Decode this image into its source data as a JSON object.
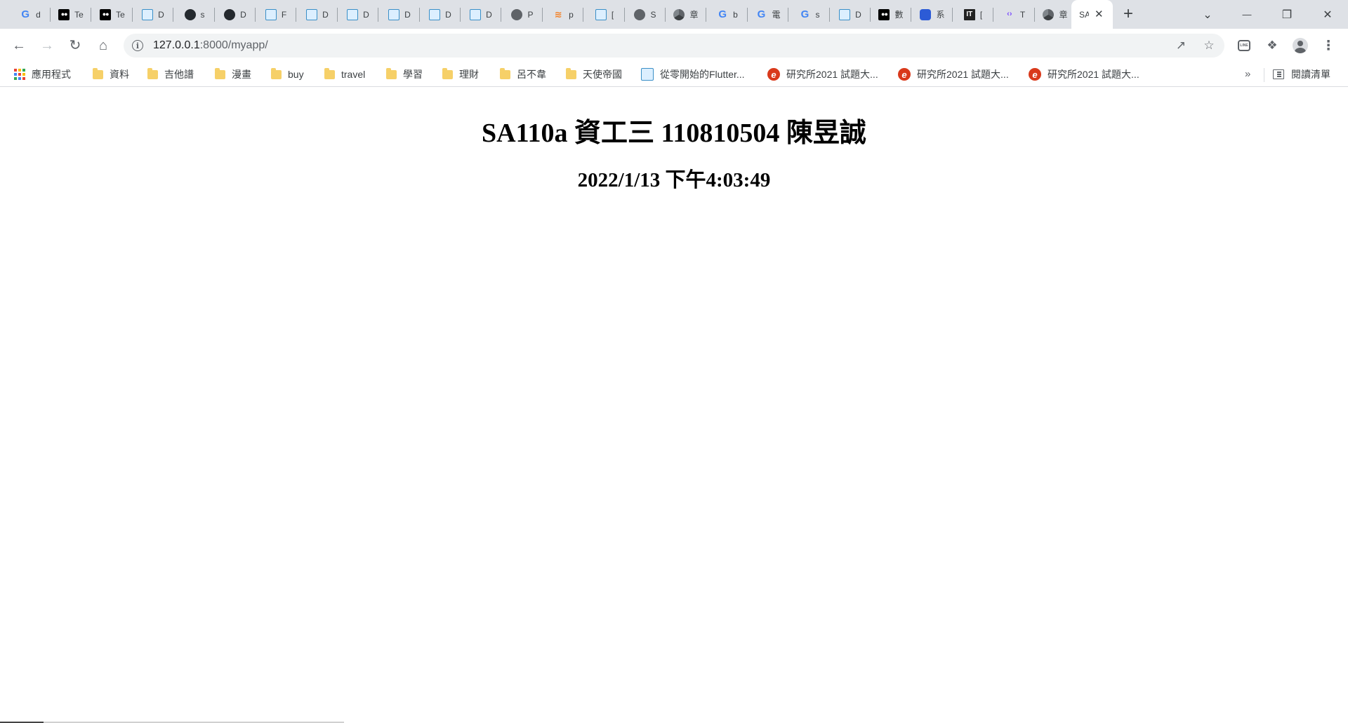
{
  "tabs": [
    {
      "favicon": "google-icon",
      "title": "d"
    },
    {
      "favicon": "medium-icon",
      "title": "Te"
    },
    {
      "favicon": "medium-icon",
      "title": "Te"
    },
    {
      "favicon": "web-icon",
      "title": "D"
    },
    {
      "favicon": "github-icon",
      "title": "s"
    },
    {
      "favicon": "github-icon",
      "title": "D"
    },
    {
      "favicon": "web-icon",
      "title": "F"
    },
    {
      "favicon": "web-icon",
      "title": "D"
    },
    {
      "favicon": "web-icon",
      "title": "D"
    },
    {
      "favicon": "web-icon",
      "title": "D"
    },
    {
      "favicon": "web-icon",
      "title": "D"
    },
    {
      "favicon": "web-icon",
      "title": "D"
    },
    {
      "favicon": "globe-icon",
      "title": "P"
    },
    {
      "favicon": "stackoverflow-icon",
      "title": "p"
    },
    {
      "favicon": "web-icon",
      "title": "["
    },
    {
      "favicon": "globe-icon",
      "title": "S"
    },
    {
      "favicon": "chrome-icon",
      "title": "章"
    },
    {
      "favicon": "google-icon",
      "title": "b"
    },
    {
      "favicon": "google-icon",
      "title": "電"
    },
    {
      "favicon": "google-icon",
      "title": "s"
    },
    {
      "favicon": "web-icon",
      "title": "D"
    },
    {
      "favicon": "medium-icon",
      "title": "數"
    },
    {
      "favicon": "blue-app-icon",
      "title": "系"
    },
    {
      "favicon": "ithome-icon",
      "title": "["
    },
    {
      "favicon": "code-icon",
      "title": "T"
    },
    {
      "favicon": "chrome-icon",
      "title": "章"
    }
  ],
  "active_tab": {
    "title": "SA",
    "close": "✕"
  },
  "new_tab_label": "+",
  "window_controls": {
    "dropdown": "⌄",
    "minimize": "—",
    "restore": "❐",
    "close": "✕"
  },
  "address_bar": {
    "host": "127.0.0.1",
    "rest": ":8000/myapp/"
  },
  "bookmarks": [
    {
      "type": "apps",
      "label": "應用程式"
    },
    {
      "type": "folder",
      "label": "資料"
    },
    {
      "type": "folder",
      "label": "吉他譜"
    },
    {
      "type": "folder",
      "label": "漫畫"
    },
    {
      "type": "folder",
      "label": "buy"
    },
    {
      "type": "folder",
      "label": "travel"
    },
    {
      "type": "folder",
      "label": "學習"
    },
    {
      "type": "folder",
      "label": "理財"
    },
    {
      "type": "folder",
      "label": "呂不韋"
    },
    {
      "type": "folder",
      "label": "天使帝國"
    },
    {
      "type": "web",
      "label": "從零開始的Flutter..."
    },
    {
      "type": "e",
      "label": "研究所2021 試題大..."
    },
    {
      "type": "e",
      "label": "研究所2021 試題大..."
    },
    {
      "type": "e",
      "label": "研究所2021 試題大..."
    }
  ],
  "bookmarks_more": "»",
  "reading_list_label": "閱讀清單",
  "page": {
    "title": "SA110a 資工三 110810504 陳昱誠",
    "datetime": "2022/1/13 下午4:03:49"
  },
  "colors": {
    "tab_strip": "#dee1e6",
    "folder": "#f6d068",
    "accent": "#1a73e8"
  }
}
